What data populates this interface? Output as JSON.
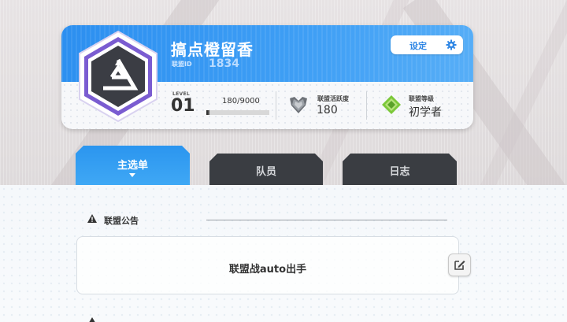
{
  "guild": {
    "name": "搞点橙留香",
    "id_label": "联盟ID",
    "id_value": "1834"
  },
  "settings": {
    "label": "设定",
    "icon": "gear-icon"
  },
  "level": {
    "label": "LEVEL",
    "value": "01",
    "xp_text": "180/9000",
    "xp_current": 180,
    "xp_max": 9000
  },
  "stats": {
    "activity": {
      "label": "联盟活跃度",
      "value": "180",
      "icon": "shield-wings-icon"
    },
    "rank": {
      "label": "联盟等级",
      "value": "初学者",
      "icon": "green-leaf-badge-icon"
    }
  },
  "tabs": [
    {
      "label": "主选单",
      "active": true
    },
    {
      "label": "队员",
      "active": false
    },
    {
      "label": "日志",
      "active": false
    }
  ],
  "notice": {
    "title": "联盟公告",
    "text": "联盟战auto出手",
    "edit_icon": "edit-icon"
  },
  "colors": {
    "header_blue": "#3a98f2",
    "tab_active": "#2f9ef0",
    "tab_inactive": "#3a3d42",
    "badge_purple": "#6b4fbf",
    "accent_green": "#7cc83a"
  }
}
